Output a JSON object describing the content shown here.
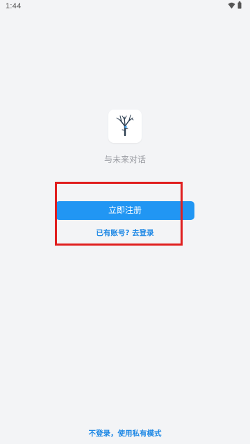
{
  "status_bar": {
    "time": "1:44",
    "icons": [
      "wifi-icon",
      "battery-icon"
    ]
  },
  "logo": {
    "icon": "tree-logo-icon"
  },
  "tagline": "与未来对话",
  "actions": {
    "register_label": "立即注册",
    "login_label": "已有账号? 去登录",
    "private_mode_label": "不登录，使用私有模式"
  },
  "colors": {
    "background": "#f3f4f6",
    "primary": "#2196f3",
    "link": "#1e88e5",
    "highlight": "#e01e1e"
  }
}
